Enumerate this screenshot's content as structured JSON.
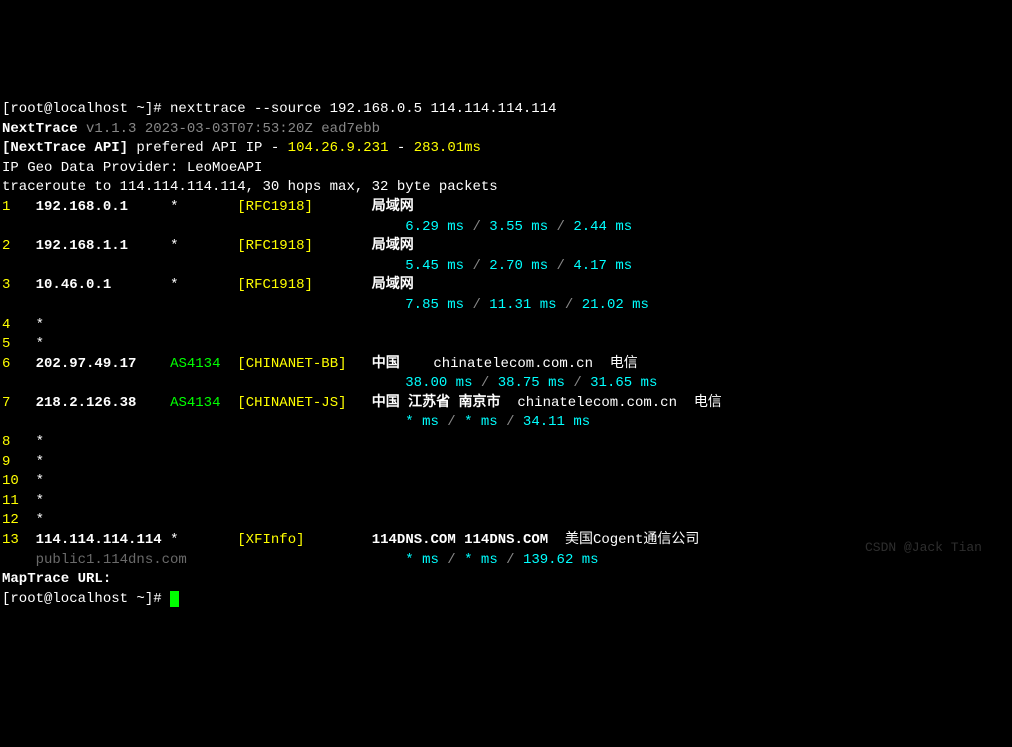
{
  "prompt1": "[root@localhost ~]# ",
  "command": "nexttrace --source 192.168.0.5 114.114.114.114",
  "banner_name": "NextTrace",
  "banner_version": " v1.1.3 2023-03-03T07:53:20Z ead7ebb",
  "api_prefix": "[NextTrace API]",
  "api_text": " prefered API IP - ",
  "api_ip": "104.26.9.231",
  "api_dash": " - ",
  "api_ms": "283.01ms",
  "geo_line": "IP Geo Data Provider: LeoMoeAPI",
  "trace_line": "traceroute to 114.114.114.114, 30 hops max, 32 byte packets",
  "hops": [
    {
      "n": "1",
      "ip": "192.168.0.1",
      "as": "*",
      "tag": "[RFC1918]",
      "lan": "局域网",
      "t1": "6.29 ms",
      "t2": "3.55 ms",
      "t3": "2.44 ms"
    },
    {
      "n": "2",
      "ip": "192.168.1.1",
      "as": "*",
      "tag": "[RFC1918]",
      "lan": "局域网",
      "t1": "5.45 ms",
      "t2": "2.70 ms",
      "t3": "4.17 ms"
    },
    {
      "n": "3",
      "ip": "10.46.0.1",
      "as": "*",
      "tag": "[RFC1918]",
      "lan": "局域网",
      "t1": "7.85 ms",
      "t2": "11.31 ms",
      "t3": "21.02 ms"
    }
  ],
  "empty": [
    {
      "n": "4"
    },
    {
      "n": "5"
    }
  ],
  "hop6": {
    "n": "6",
    "ip": "202.97.49.17",
    "as": "AS4134",
    "tag": "[CHINANET-BB]",
    "geo": "中国",
    "dom": "chinatelecom.com.cn",
    "isp": "电信",
    "t1": "38.00 ms",
    "t2": "38.75 ms",
    "t3": "31.65 ms"
  },
  "hop7": {
    "n": "7",
    "ip": "218.2.126.38",
    "as": "AS4134",
    "tag": "[CHINANET-JS]",
    "geo": "中国 江苏省 南京市",
    "dom": "chinatelecom.com.cn",
    "isp": "电信",
    "t1": "* ms",
    "t2": "* ms",
    "t3": "34.11 ms"
  },
  "empty2": [
    {
      "n": "8"
    },
    {
      "n": "9"
    },
    {
      "n": "10"
    },
    {
      "n": "11"
    },
    {
      "n": "12"
    }
  ],
  "hop13": {
    "n": "13",
    "ip": "114.114.114.114",
    "as": "*",
    "tag": "[XFInfo]",
    "geo": "114DNS.COM 114DNS.COM",
    "isp": "美国Cogent通信公司",
    "rdns": "public1.114dns.com",
    "t1": "* ms",
    "t2": "* ms",
    "t3": "139.62 ms"
  },
  "maptrace": "MapTrace URL:",
  "prompt2": "[root@localhost ~]# ",
  "watermark": "CSDN @Jack Tian"
}
